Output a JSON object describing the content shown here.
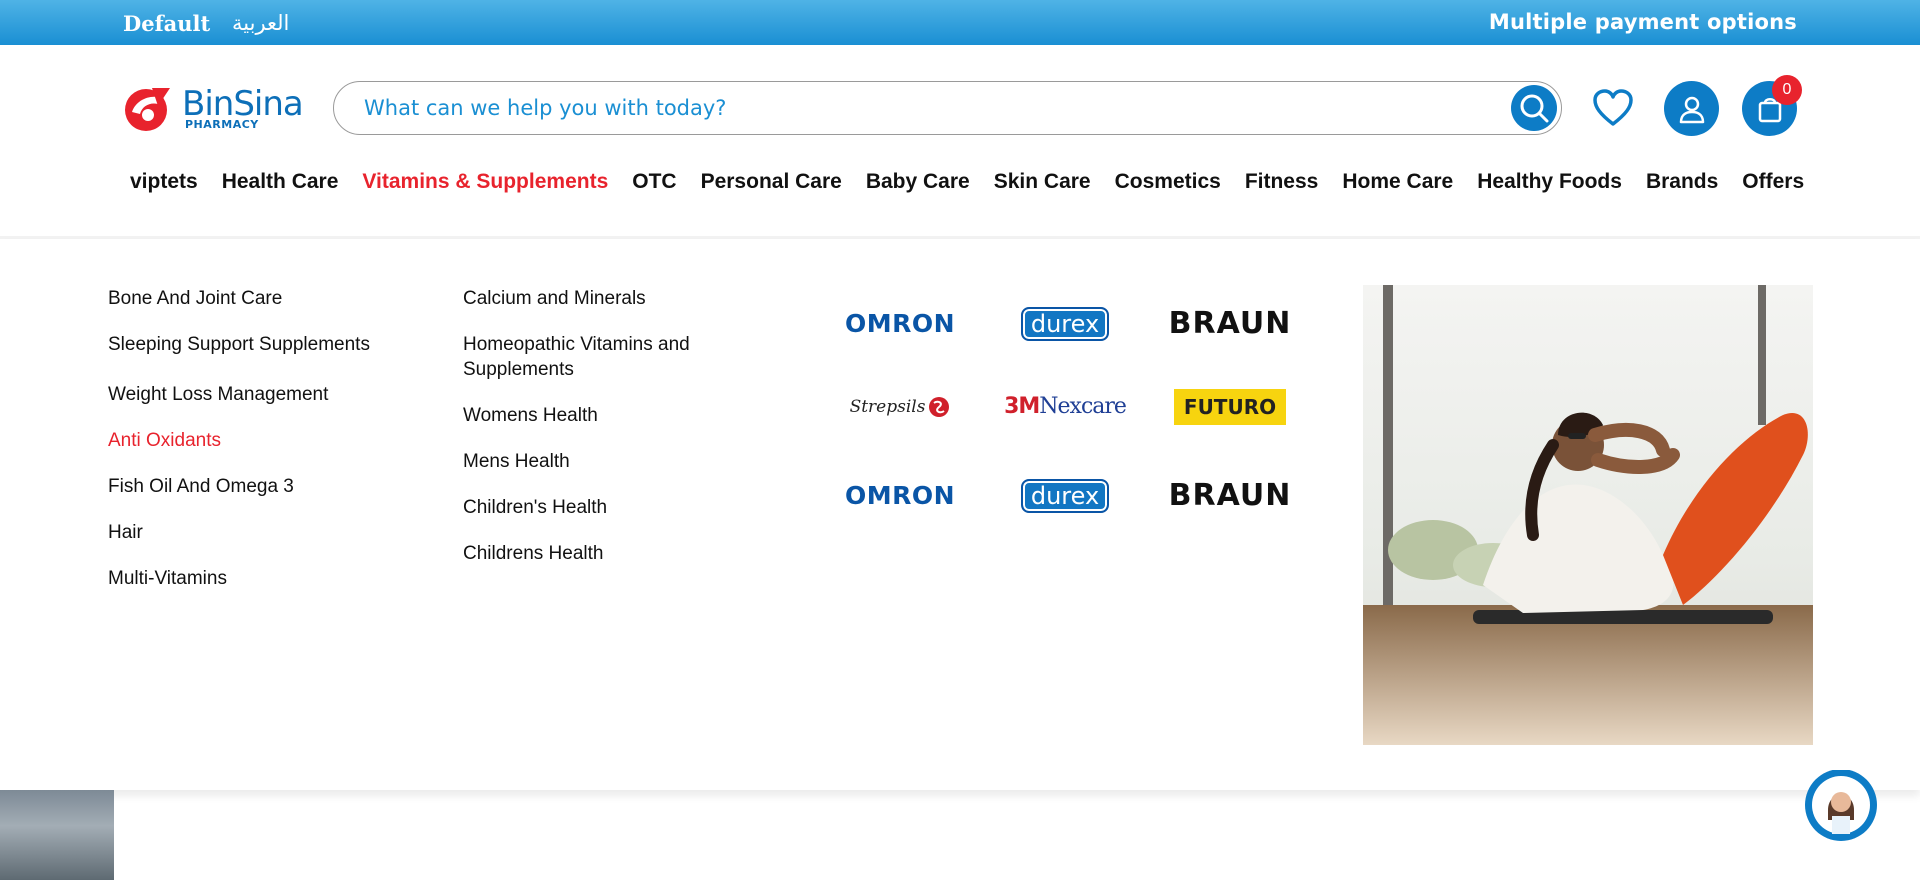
{
  "topbar": {
    "lang_default": "Default",
    "lang_arabic": "العربية",
    "promo_text": "Multiple payment options"
  },
  "header": {
    "logo_text": "BinSina",
    "logo_sub": "PHARMACY",
    "search_placeholder": "What can we help you with today?",
    "cart_count": "0"
  },
  "nav": {
    "items": [
      {
        "label": "viptets"
      },
      {
        "label": "Health Care"
      },
      {
        "label": "Vitamins & Supplements"
      },
      {
        "label": "OTC"
      },
      {
        "label": "Personal Care"
      },
      {
        "label": "Baby Care"
      },
      {
        "label": "Skin Care"
      },
      {
        "label": "Cosmetics"
      },
      {
        "label": "Fitness"
      },
      {
        "label": "Home Care"
      },
      {
        "label": "Healthy Foods"
      },
      {
        "label": "Brands"
      },
      {
        "label": "Offers"
      }
    ],
    "active": "Vitamins & Supplements"
  },
  "mega_menu": {
    "col1": [
      "Bone And Joint Care",
      "Sleeping Support Supplements",
      "Weight Loss Management",
      "Anti Oxidants",
      "Fish Oil And Omega 3",
      "Hair",
      "Multi-Vitamins"
    ],
    "col2": [
      "Calcium and Minerals",
      "Homeopathic Vitamins and Supplements",
      "Womens Health",
      "Mens Health",
      "Children's Health",
      "Childrens Health"
    ],
    "active_item": "Anti Oxidants",
    "brands": {
      "omron": "OMRON",
      "durex": "durex",
      "braun": "BRAUN",
      "strepsils": "Strepsils",
      "nexcare_3m": "3M",
      "nexcare": "Nexcare",
      "futuro": "FUTURO"
    }
  },
  "colors": {
    "brand_blue": "#0d7cc6",
    "accent_red": "#e8232d",
    "topbar_gradient": "#1a8fd3"
  }
}
